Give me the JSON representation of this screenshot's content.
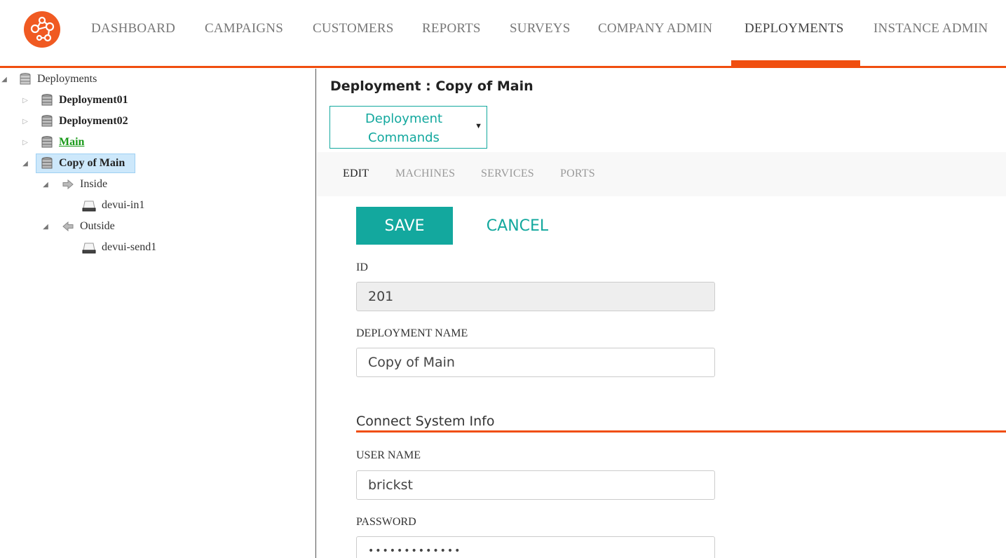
{
  "brand": {
    "accent": "#f04e0f",
    "teal": "#13a89e",
    "logo_icon": "network-nodes-icon"
  },
  "nav": {
    "items": [
      {
        "label": "DASHBOARD"
      },
      {
        "label": "CAMPAIGNS"
      },
      {
        "label": "CUSTOMERS"
      },
      {
        "label": "REPORTS"
      },
      {
        "label": "SURVEYS"
      },
      {
        "label": "COMPANY ADMIN"
      },
      {
        "label": "DEPLOYMENTS",
        "active": true
      },
      {
        "label": "INSTANCE ADMIN"
      }
    ]
  },
  "tree": {
    "root": {
      "label": "Deployments",
      "icon": "database-icon"
    },
    "items": [
      {
        "label": "Deployment01",
        "icon": "database-icon"
      },
      {
        "label": "Deployment02",
        "icon": "database-icon"
      },
      {
        "label": "Main",
        "icon": "database-icon"
      },
      {
        "label": "Copy of Main",
        "icon": "database-icon",
        "selected": true
      }
    ],
    "groups": [
      {
        "label": "Inside",
        "icon": "arrow-right-icon",
        "children": [
          {
            "label": "devui-in1",
            "icon": "machine-icon"
          }
        ]
      },
      {
        "label": "Outside",
        "icon": "arrow-left-icon",
        "children": [
          {
            "label": "devui-send1",
            "icon": "machine-icon"
          }
        ]
      }
    ]
  },
  "main": {
    "title": "Deployment : Copy of Main",
    "commands_label": "Deployment Commands",
    "tabs": [
      {
        "label": "EDIT",
        "active": true
      },
      {
        "label": "MACHINES"
      },
      {
        "label": "SERVICES"
      },
      {
        "label": "PORTS"
      }
    ],
    "save_label": "SAVE",
    "cancel_label": "CANCEL",
    "fields": {
      "id_label": "ID",
      "id_value": "201",
      "name_label": "DEPLOYMENT NAME",
      "name_value": "Copy of Main",
      "section_title": "Connect System Info",
      "user_label": "USER NAME",
      "user_value": "brickst",
      "password_label": "PASSWORD",
      "password_value": "•••••••••••••"
    }
  }
}
